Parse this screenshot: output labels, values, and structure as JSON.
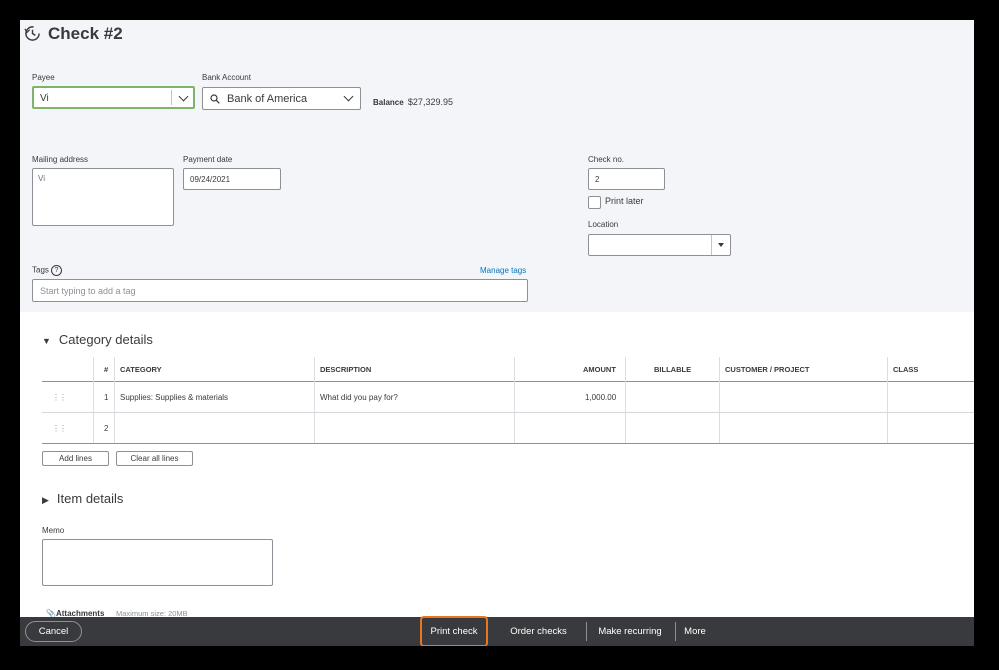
{
  "header": {
    "title": "Check #2",
    "icon": "history-icon"
  },
  "payee": {
    "label": "Payee",
    "value": "Vi"
  },
  "bank_account": {
    "label": "Bank Account",
    "value": "Bank of America",
    "balance_label": "Balance",
    "balance_value": "$27,329.95"
  },
  "mailing_address": {
    "label": "Mailing address",
    "value": "Vi"
  },
  "payment_date": {
    "label": "Payment date",
    "value": "09/24/2021"
  },
  "check_no": {
    "label": "Check no.",
    "value": "2"
  },
  "print_later": {
    "label": "Print later",
    "checked": false
  },
  "location": {
    "label": "Location",
    "value": ""
  },
  "tags": {
    "label": "Tags",
    "placeholder": "Start typing to add a tag",
    "manage_link": "Manage tags"
  },
  "category_details": {
    "title": "Category details",
    "columns": [
      "#",
      "CATEGORY",
      "DESCRIPTION",
      "AMOUNT",
      "BILLABLE",
      "CUSTOMER / PROJECT",
      "CLASS"
    ],
    "rows": [
      {
        "num": "1",
        "category": "Supplies: Supplies & materials",
        "description_placeholder": "What did you pay for?",
        "amount": "1,000.00"
      },
      {
        "num": "2",
        "category": "",
        "description_placeholder": "",
        "amount": ""
      }
    ],
    "add_lines": "Add lines",
    "clear_all_lines": "Clear all lines"
  },
  "item_details": {
    "title": "Item details"
  },
  "memo": {
    "label": "Memo",
    "value": ""
  },
  "attachments": {
    "label": "Attachments",
    "max_size": "Maximum size: 20MB"
  },
  "footer": {
    "cancel": "Cancel",
    "print_check": "Print check",
    "order_checks": "Order checks",
    "make_recurring": "Make recurring",
    "more": "More",
    "highlight_color": "#e87722"
  },
  "colors": {
    "accent_green": "#7db36b",
    "link_blue": "#0077c5",
    "footer_bg": "#393a3d"
  }
}
